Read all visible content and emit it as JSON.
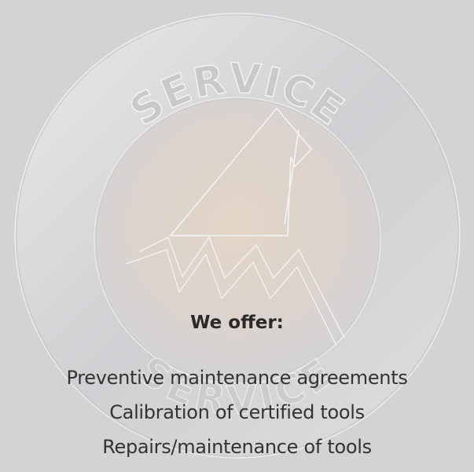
{
  "emblem": {
    "text_top": "SERVICE",
    "text_bottom": "SERVICE",
    "icon": "service-mountain-emblem-icon"
  },
  "heading": "We offer:",
  "offers": [
    "Preventive maintenance agreements",
    "Calibration of certified tools",
    "Repairs/maintenance of tools"
  ],
  "colors": {
    "background": "#d3d3d5",
    "text": "#333333",
    "emblem_center": "#e2d6c9"
  }
}
